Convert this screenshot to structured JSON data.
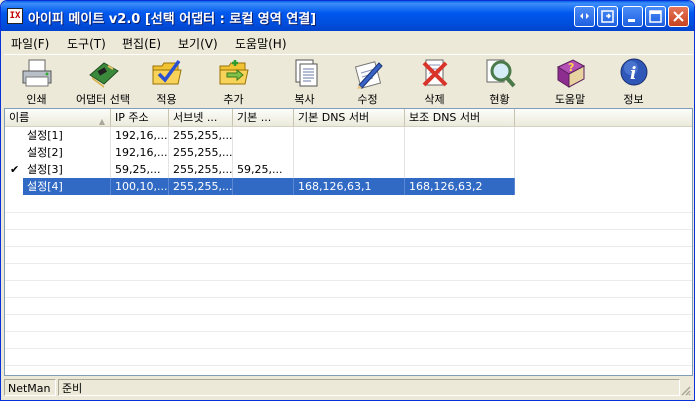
{
  "window": {
    "icon_text": "IX",
    "title": "아이피 메이트 v2.0  [선택 어댑터 : 로컬 영역 연결]",
    "buttons": [
      "dock-icon",
      "restore-dock-icon",
      "minimize-icon",
      "maximize-icon",
      "close-icon"
    ]
  },
  "menu": [
    {
      "label": "파일(F)"
    },
    {
      "label": "도구(T)"
    },
    {
      "label": "편집(E)"
    },
    {
      "label": "보기(V)"
    },
    {
      "label": "도움말(H)"
    }
  ],
  "toolbar": [
    {
      "label": "인쇄",
      "icon": "printer-icon"
    },
    {
      "label": "어댑터 선택",
      "icon": "network-card-icon"
    },
    {
      "label": "적용",
      "icon": "apply-folder-icon"
    },
    {
      "label": "추가",
      "icon": "add-folder-icon"
    },
    {
      "label": "복사",
      "icon": "copy-document-icon"
    },
    {
      "label": "수정",
      "icon": "edit-pen-icon"
    },
    {
      "label": "삭제",
      "icon": "delete-icon"
    },
    {
      "label": "현황",
      "icon": "magnifier-icon"
    },
    {
      "label": "도움말",
      "icon": "help-book-icon"
    },
    {
      "label": "정보",
      "icon": "info-icon"
    }
  ],
  "list": {
    "columns": [
      "이름",
      "IP 주소",
      "서브넷 ...",
      "기본 ...",
      "기본 DNS 서버",
      "보조 DNS 서버"
    ],
    "rows": [
      {
        "checked": false,
        "selected": false,
        "cells": [
          "설정[1]",
          "192,16,...",
          "255,255,...",
          "",
          "",
          ""
        ]
      },
      {
        "checked": false,
        "selected": false,
        "cells": [
          "설정[2]",
          "192,16,...",
          "255,255,...",
          "",
          "",
          ""
        ]
      },
      {
        "checked": true,
        "selected": false,
        "cells": [
          "설정[3]",
          "59,25,...",
          "255,255,...",
          "59,25,...",
          "",
          ""
        ]
      },
      {
        "checked": false,
        "selected": true,
        "cells": [
          "설정[4]",
          "100,10,...",
          "255,255,...",
          "",
          "168,126,63,1",
          "168,126,63,2"
        ]
      }
    ],
    "check_mark": "✔"
  },
  "status": {
    "pane1": "NetMan",
    "pane2": "준비"
  },
  "colors": {
    "title_bar": "#0055e5",
    "selection": "#316ac5",
    "window_bg": "#ece9d8"
  }
}
